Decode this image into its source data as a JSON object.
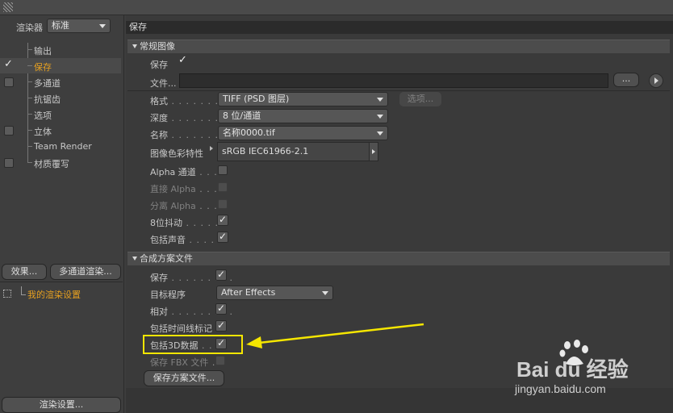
{
  "left": {
    "renderer_label": "渲染器",
    "renderer_value": "标准",
    "nav": [
      {
        "label": "输出",
        "check": "none",
        "active": false
      },
      {
        "label": "保存",
        "check": "checked",
        "active": true
      },
      {
        "label": "多通道",
        "check": "box",
        "active": false
      },
      {
        "label": "抗锯齿",
        "check": "none",
        "active": false
      },
      {
        "label": "选项",
        "check": "none",
        "active": false
      },
      {
        "label": "立体",
        "check": "box",
        "active": false
      },
      {
        "label": "Team Render",
        "check": "none",
        "active": false
      },
      {
        "label": "材质覆写",
        "check": "box",
        "active": false
      }
    ],
    "effects_button": "效果...",
    "multipass_button": "多通道渲染...",
    "settings_item": "我的渲染设置",
    "render_settings_button": "渲染设置..."
  },
  "right": {
    "header_title": "保存",
    "regular": {
      "section_title": "常规图像",
      "save_label": "保存",
      "save_checked": true,
      "file_label": "文件...",
      "file_value": "",
      "browse_button": "...",
      "format_label": "格式",
      "format_value": "TIFF (PSD 图层)",
      "options_button": "选项...",
      "depth_label": "深度",
      "depth_value": "8 位/通道",
      "name_label": "名称",
      "name_value": "名称0000.tif",
      "color_profile_label": "图像色彩特性",
      "color_profile_value": "sRGB IEC61966-2.1",
      "alpha_label": "Alpha 通道",
      "alpha_checked": false,
      "straight_alpha_label": "直接 Alpha",
      "separate_alpha_label": "分离 Alpha",
      "dither_label": "8位抖动",
      "dither_checked": true,
      "sound_label": "包括声音",
      "sound_checked": true
    },
    "compositing": {
      "section_title": "合成方案文件",
      "save_label": "保存",
      "save_checked": true,
      "target_label": "目标程序",
      "target_value": "After Effects",
      "relative_label": "相对",
      "relative_checked": true,
      "timeline_label": "包括时间线标记",
      "timeline_checked": true,
      "include3d_label": "包括3D数据",
      "include3d_checked": true,
      "fbx_label": "保存 FBX 文件",
      "save_file_button": "保存方案文件..."
    }
  },
  "watermark": {
    "brand": "Bai du 经验",
    "url": "jingyan.baidu.com"
  },
  "colors": {
    "active_nav": "#e6a020",
    "highlight_box": "#f5e600",
    "annotation_arrow": "#f5e600"
  }
}
